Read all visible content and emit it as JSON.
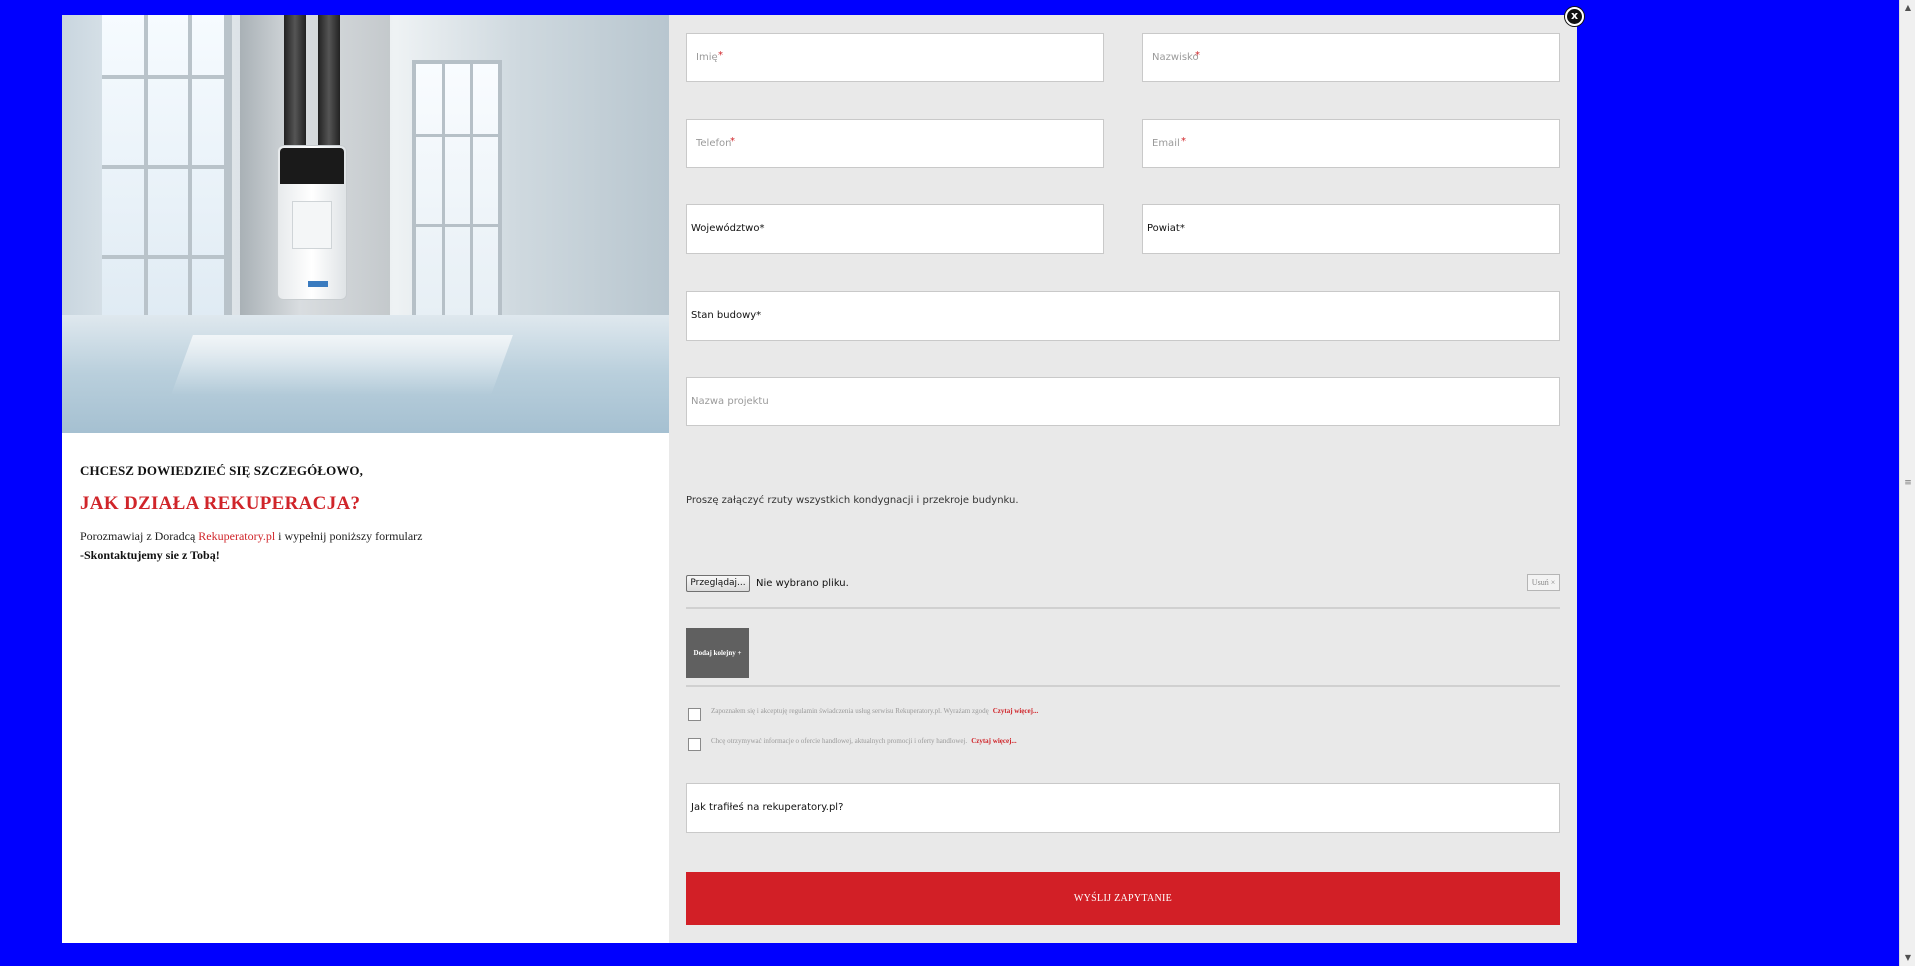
{
  "modal": {
    "close_label": "x"
  },
  "promo": {
    "heading": "CHCESZ DOWIEDZIEĆ SIĘ SZCZEGÓŁOWO,",
    "title": "JAK DZIAŁA REKUPERACJA?",
    "body_prefix": "Porozmawiaj z Doradcą ",
    "body_link": "Rekuperatory.pl",
    "body_suffix": " i wypełnij poniższy formularz",
    "body_cta": "-Skontaktujemy sie z Tobą!"
  },
  "form": {
    "first_name": {
      "placeholder": "Imię",
      "required_mark": "*"
    },
    "last_name": {
      "placeholder": "Nazwisko",
      "required_mark": "*"
    },
    "phone": {
      "placeholder": "Telefon",
      "required_mark": "*"
    },
    "email": {
      "placeholder": "Email",
      "required_mark": "*"
    },
    "voivodeship": {
      "label": "Województwo",
      "required_mark": "*"
    },
    "county": {
      "label": "Powiat",
      "required_mark": "*"
    },
    "build_stage": {
      "label": "Stan budowy",
      "required_mark": "*"
    },
    "project_name": {
      "placeholder": "Nazwa projektu"
    },
    "attachment_info": "Proszę załączyć rzuty wszystkich kondygnacji i przekroje budynku.",
    "file": {
      "browse_label": "Przeglądaj...",
      "status": "Nie wybrano pliku.",
      "remove_label": "Usuń ×"
    },
    "add_more_label": "Dodaj kolejny +",
    "consents": [
      {
        "text": "Zapoznałem się i akceptuję regulamin świadczenia usług serwisu Rekuperatory.pl. Wyrażam zgodę",
        "more": "Czytaj więcej..."
      },
      {
        "text": "Chcę otrzymywać informacje o ofercie handlowej, aktualnych promocji i oferty handlowej.",
        "more": "Czytaj więcej..."
      }
    ],
    "referral": {
      "label": "Jak trafiłeś na rekuperatory.pl?"
    },
    "submit_label": "WYŚLIJ ZAPYTANIE"
  },
  "colors": {
    "background": "#0000ff",
    "accent": "#d21f26",
    "form_bg": "#e9e9e9"
  }
}
